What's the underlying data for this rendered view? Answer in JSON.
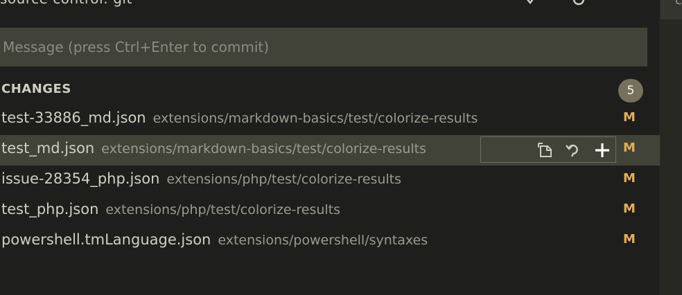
{
  "header": {
    "title": "source control: git",
    "icons": [
      "checkmark-icon",
      "refresh-icon"
    ]
  },
  "commit": {
    "placeholder": "Message (press Ctrl+Enter to commit)",
    "value": ""
  },
  "changes": {
    "label": "CHANGES",
    "count": "5",
    "items": [
      {
        "file": "test-33886_md.json",
        "path": "extensions/markdown-basics/test/colorize-results",
        "status": "M"
      },
      {
        "file": "test_md.json",
        "path": "extensions/markdown-basics/test/colorize-results",
        "status": "M",
        "selected": true
      },
      {
        "file": "issue-28354_php.json",
        "path": "extensions/php/test/colorize-results",
        "status": "M"
      },
      {
        "file": "test_php.json",
        "path": "extensions/php/test/colorize-results",
        "status": "M"
      },
      {
        "file": "powershell.tmLanguage.json",
        "path": "extensions/powershell/syntaxes",
        "status": "M"
      }
    ]
  },
  "row_actions": [
    "open-file-icon",
    "discard-changes-icon",
    "stage-changes-icon"
  ],
  "right_panel": {
    "tab_char": "c"
  },
  "colors": {
    "background": "#1e1f1c",
    "input_background": "#414339",
    "badge": "#75715e",
    "modified": "#e6ad57",
    "text": "#cfcfc2",
    "muted_text": "#9a9a90"
  }
}
